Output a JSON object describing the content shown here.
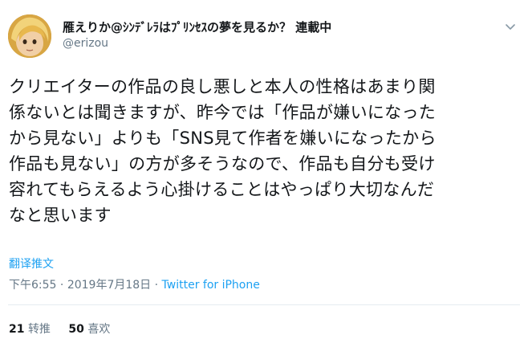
{
  "author": {
    "display_name": "雁えりか@ｼﾝﾃﾞﾚﾗはﾌﾟﾘﾝｾｽの夢を見るか？ 連載中",
    "handle": "@erizou",
    "avatar_icon": "avatar-image"
  },
  "menu": {
    "icon": "chevron-down-icon"
  },
  "tweet": {
    "text": "クリエイターの作品の良し悪しと本人の性格はあまり関\n係ないとは聞きますが、昨今では「作品が嫌いになった\nから見ない」よりも「SNS見て作者を嫌いになったから\n作品も見ない」の方が多そうなので、作品も自分も受け\n容れてもらえるよう心掛けることはやっぱり大切なんだ\nなと思います",
    "translate_label": "翻译推文"
  },
  "meta": {
    "time": "下午6:55",
    "separator": "·",
    "date": "2019年7月18日",
    "source": "Twitter for iPhone"
  },
  "stats": {
    "retweets_count": "21",
    "retweets_label": "转推",
    "likes_count": "50",
    "likes_label": "喜欢"
  }
}
